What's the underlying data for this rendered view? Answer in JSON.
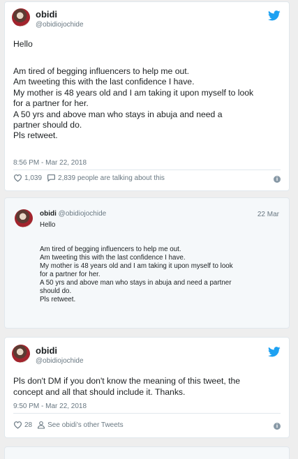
{
  "tweet1": {
    "name": "obidi",
    "handle": "@obidiojochide",
    "lines": [
      "Hello",
      "",
      "Am tired of begging influencers to help me out.",
      "Am tweeting this with the last confidence I have.",
      "My mother is 48 years old and I am taking it upon myself to look",
      "for a partner for her.",
      "A 50 yrs and above man who stays in abuja and need a",
      "partner should do.",
      "Pls retweet."
    ],
    "timestamp": "8:56 PM - Mar 22, 2018",
    "likes": "1,039",
    "talking": "2,839 people are talking about this"
  },
  "quoted": {
    "name": "obidi",
    "handle": "@obidiojochide",
    "date": "22 Mar",
    "lines": [
      "Hello",
      "",
      "Am tired of begging influencers to help me out.",
      "Am tweeting this with the last confidence I have.",
      "My mother is 48 years old and I am taking it upon myself to look",
      "for a partner for her.",
      "A 50 yrs and above man who stays in abuja and need a partner",
      "should do.",
      "Pls retweet."
    ]
  },
  "tweet2": {
    "name": "obidi",
    "handle": "@obidiojochide",
    "lines": [
      "Pls don't DM if you don't know the meaning of this tweet, the",
      "concept and all that should include it. Thanks."
    ],
    "timestamp": "9:50 PM - Mar 22, 2018",
    "likes": "28",
    "other_tweets": "See obidi's other Tweets"
  },
  "colors": {
    "twitter_blue": "#1da1f2",
    "text": "#1c2022",
    "meta": "#697882",
    "border": "#e1e8ed"
  },
  "icons": [
    "twitter-bird-icon",
    "heart-icon",
    "reply-bubble-icon",
    "person-icon",
    "info-icon"
  ]
}
